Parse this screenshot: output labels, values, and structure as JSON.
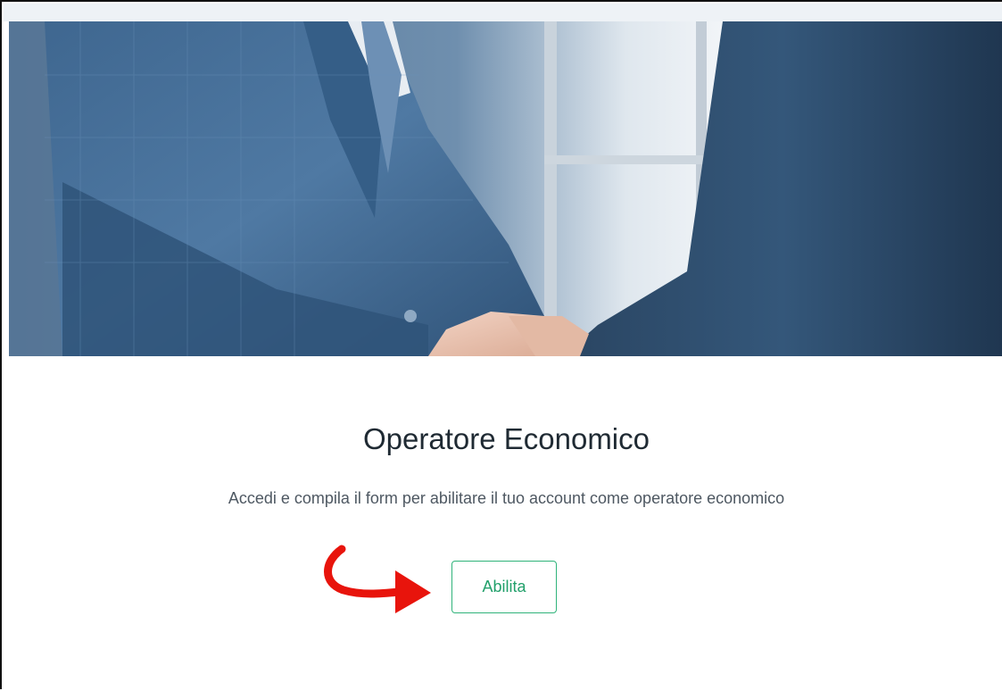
{
  "card": {
    "title": "Operatore Economico",
    "description": "Accedi e compila il form per abilitare il tuo account come operatore economico",
    "enable_button_label": "Abilita"
  },
  "colors": {
    "accent": "#2fb37a",
    "title_text": "#1f2a33",
    "body_text": "#4e5862",
    "annotation_arrow": "#e8140c"
  },
  "icons": {
    "annotation": "red-curved-arrow-icon"
  }
}
